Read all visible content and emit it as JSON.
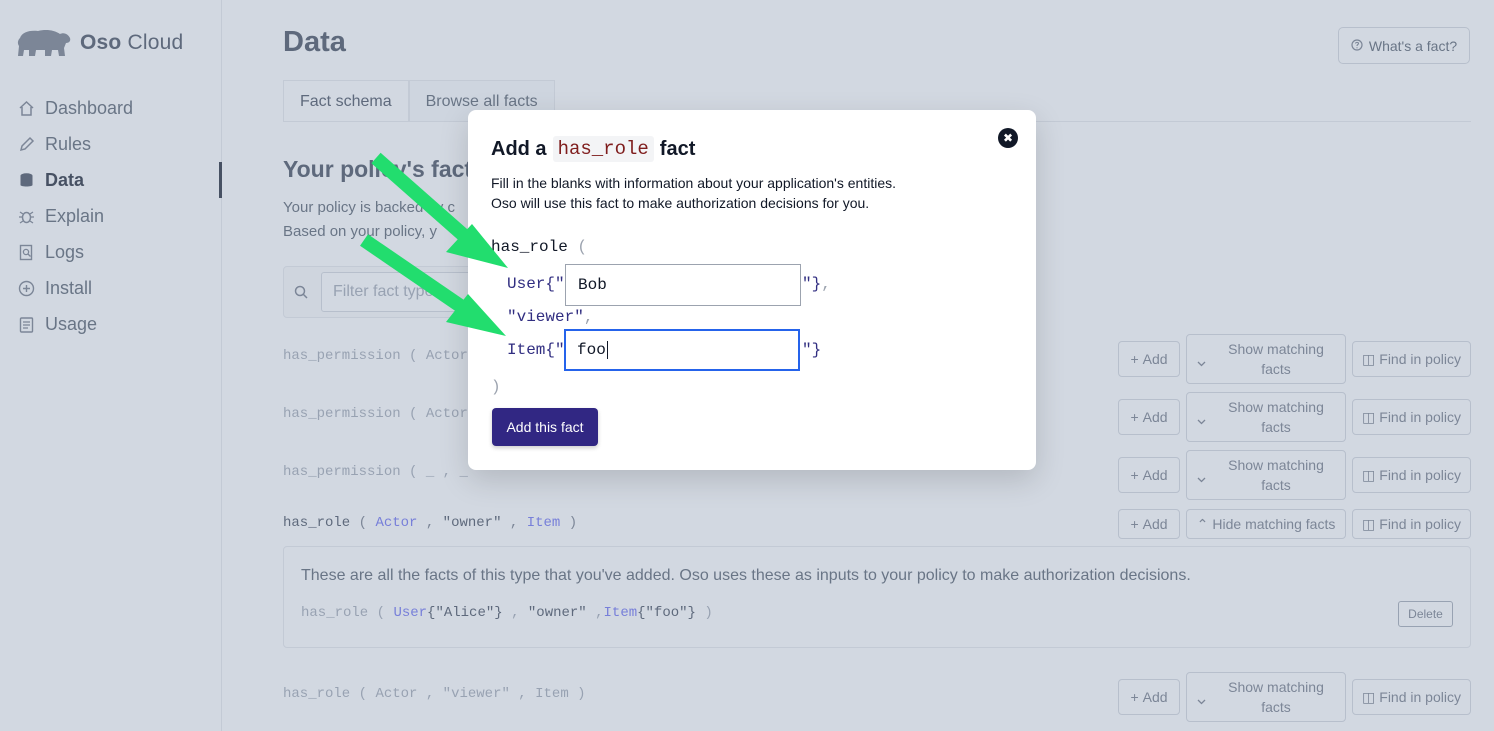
{
  "app": {
    "brand_bold": "Oso",
    "brand_light": "Cloud"
  },
  "sidebar": {
    "items": [
      {
        "label": "Dashboard",
        "icon": "home-icon"
      },
      {
        "label": "Rules",
        "icon": "pencil-icon"
      },
      {
        "label": "Data",
        "icon": "database-icon",
        "active": true
      },
      {
        "label": "Explain",
        "icon": "bug-icon"
      },
      {
        "label": "Logs",
        "icon": "search-document-icon"
      },
      {
        "label": "Install",
        "icon": "plus-circle-icon"
      },
      {
        "label": "Usage",
        "icon": "clipboard-icon"
      }
    ]
  },
  "header": {
    "title": "Data",
    "help_label": "What's a fact?"
  },
  "tabs": [
    {
      "label": "Fact schema",
      "active": true
    },
    {
      "label": "Browse all facts"
    }
  ],
  "section": {
    "title": "Your policy's facts",
    "desc_line1": "Your policy is backed by c",
    "desc_line2": "Based on your policy, y"
  },
  "filter": {
    "placeholder": "Filter fact types"
  },
  "fact_rows": [
    {
      "name": "has_permission",
      "sig": "( Actor"
    },
    {
      "name": "has_permission",
      "sig": "( Actor"
    },
    {
      "name": "has_permission",
      "sig": "( _ , _"
    },
    {
      "name": "has_role",
      "arg1": "Actor",
      "arg2": "\"owner\"",
      "arg3": "Item"
    },
    {
      "name": "has_role",
      "arg1": "Actor",
      "arg2": "\"viewer\"",
      "arg3": "Item"
    }
  ],
  "buttons": {
    "add": "Add",
    "show_matching": "Show matching facts",
    "hide_matching": "Hide matching facts",
    "find_in_policy": "Find in policy",
    "delete": "Delete"
  },
  "facts_box": {
    "note": "These are all the facts of this type that you've added. Oso uses these as inputs to your policy to make authorization decisions.",
    "entry": {
      "name": "has_role",
      "user_type": "User",
      "user_id": "\"Alice\"",
      "role": "\"owner\"",
      "item_type": "Item",
      "item_id": "\"foo\""
    }
  },
  "modal": {
    "title_prefix": "Add a",
    "title_code": "has_role",
    "title_suffix": "fact",
    "desc_line1": "Fill in the blanks with information about your application's entities.",
    "desc_line2": "Oso will use this fact to make authorization decisions for you.",
    "fn_name": "has_role",
    "open_paren": "(",
    "close_paren": ")",
    "user_type": "User{\"",
    "user_close": "\"}",
    "user_value": "Bob",
    "role_value": "\"viewer\"",
    "item_type": "Item{\"",
    "item_close": "\"}",
    "item_value": "foo",
    "submit": "Add this fact",
    "close_icon": "close-icon"
  },
  "colors": {
    "accent": "#312783",
    "arrow": "#22dd6e",
    "focus": "#2563eb"
  }
}
